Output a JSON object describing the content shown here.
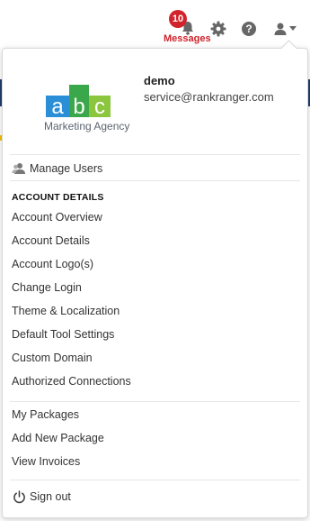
{
  "topbar": {
    "notifications_count": "10",
    "messages_label": "Messages",
    "icons": [
      "bell-icon",
      "gear-icon",
      "help-icon",
      "user-icon"
    ]
  },
  "profile": {
    "logo_text": "Marketing Agency",
    "logo_letters": [
      "a",
      "b",
      "c"
    ],
    "logo_colors": [
      "#2a8fd6",
      "#3aa74a",
      "#7fbf3f"
    ],
    "username": "demo",
    "email": "service@rankranger.com"
  },
  "menu": {
    "manage_users": "Manage Users",
    "account_details_title": "ACCOUNT DETAILS",
    "account_items": [
      "Account Overview",
      "Account Details",
      "Account Logo(s)",
      "Change Login",
      "Theme & Localization",
      "Default Tool Settings",
      "Custom Domain",
      "Authorized Connections"
    ],
    "package_items": [
      "My Packages",
      "Add New Package",
      "View Invoices"
    ],
    "sign_out": "Sign out"
  },
  "colors": {
    "badge": "#d0232b",
    "icon_gray": "#666666"
  }
}
